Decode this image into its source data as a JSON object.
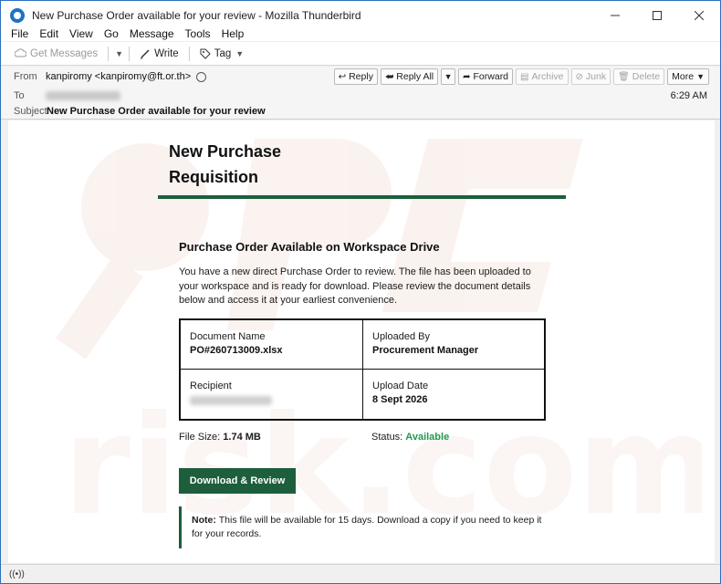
{
  "window": {
    "title": "New Purchase Order available for your review - Mozilla Thunderbird",
    "controls": {
      "minimize": "–",
      "maximize": "☐",
      "close": "✕"
    }
  },
  "menubar": {
    "items": [
      "File",
      "Edit",
      "View",
      "Go",
      "Message",
      "Tools",
      "Help"
    ]
  },
  "toolbar": {
    "get_messages": "Get Messages",
    "write": "Write",
    "tag": "Tag"
  },
  "header": {
    "from_label": "From",
    "from_value": "kanpiromy <kanpiromy@ft.or.th>",
    "to_label": "To",
    "subject_label": "Subject",
    "subject_value": "New Purchase Order available for your review",
    "time": "6:29 AM",
    "actions": {
      "reply": "Reply",
      "reply_all": "Reply All",
      "forward": "Forward",
      "archive": "Archive",
      "junk": "Junk",
      "delete": "Delete",
      "more": "More"
    }
  },
  "email": {
    "title_line1": "New Purchase",
    "title_line2": "Requisition",
    "heading": "Purchase Order Available on Workspace Drive",
    "intro": "You have a new direct Purchase Order to review. The file has been uploaded to your workspace and is ready for download. Please review the document details below and access it at your earliest convenience.",
    "details": {
      "doc_name_label": "Document Name",
      "doc_name_value": "PO#260713009.xlsx",
      "uploaded_by_label": "Uploaded By",
      "uploaded_by_value": "Procurement Manager",
      "recipient_label": "Recipient",
      "upload_date_label": "Upload Date",
      "upload_date_value": "8 Sept 2026"
    },
    "file_size_label": "File Size:",
    "file_size_value": "1.74 MB",
    "status_label": "Status:",
    "status_value": "Available",
    "button_label": "Download & Review",
    "note_label": "Note:",
    "note_text": "This file will be available for 15 days. Download a copy if you need to keep it for your records."
  },
  "colors": {
    "accent_green": "#1d5e3c",
    "status_green": "#219a4f"
  }
}
